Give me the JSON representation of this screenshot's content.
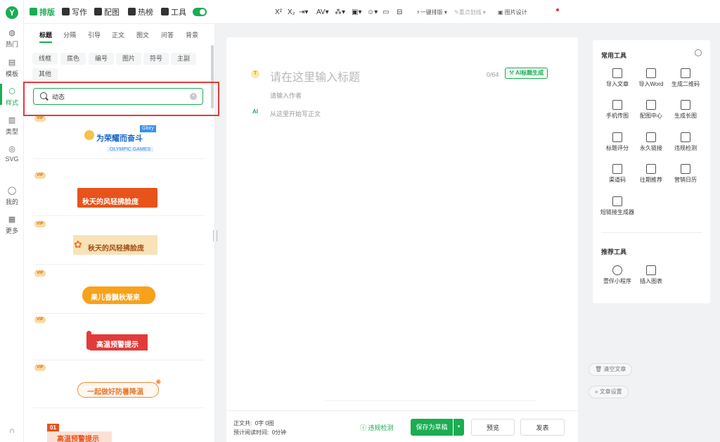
{
  "rail": {
    "items": [
      {
        "label": "热门",
        "icon": "flame-icon"
      },
      {
        "label": "模板",
        "icon": "template-icon"
      },
      {
        "label": "样式",
        "icon": "style-icon",
        "active": true
      },
      {
        "label": "类型",
        "icon": "type-icon"
      },
      {
        "label": "SVG",
        "icon": "svg-icon"
      },
      {
        "label": "我的",
        "icon": "user-icon"
      },
      {
        "label": "更多",
        "icon": "grid-icon"
      }
    ]
  },
  "topbar": {
    "tabs": [
      {
        "label": "排版",
        "active": true
      },
      {
        "label": "写作"
      },
      {
        "label": "配图"
      },
      {
        "label": "热榜"
      },
      {
        "label": "工具"
      }
    ],
    "tools": {
      "superscript": "X²",
      "subscript": "X₂",
      "one_click": "一键排版",
      "highlight": "重点划线",
      "image_design": "图片设计"
    }
  },
  "style_panel": {
    "tabs": [
      "标题",
      "分隔",
      "引导",
      "正文",
      "图文",
      "问答",
      "背景"
    ],
    "chips": [
      "线框",
      "底色",
      "编号",
      "图片",
      "符号",
      "主副",
      "其他"
    ],
    "search": {
      "value": "动态"
    },
    "vip_label": "VIP",
    "templates": [
      {
        "text": "为荣耀而奋斗",
        "badge": "Glory",
        "sub": "OLYMPIC GAMES"
      },
      {
        "text": "秋天的风轻拂脸庞"
      },
      {
        "text": "秋天的风轻拂脸庞"
      },
      {
        "text": "果儿香飘秋渐来"
      },
      {
        "text": "高温预警提示"
      },
      {
        "text": "一起做好防暑降温"
      },
      {
        "text": "高温预警提示",
        "badge": "01"
      }
    ]
  },
  "editor": {
    "title_placeholder": "请在这里输入标题",
    "title_count": "0/64",
    "ai_button": "AI标题生成",
    "author_placeholder": "请输入作者",
    "body_placeholder": "从这里开始写正文"
  },
  "footer": {
    "word_count_label": "正文共:",
    "word_count_value": "0字 0图",
    "read_time_label": "预计阅读时间:",
    "read_time_value": "0分钟",
    "check": "违规检测",
    "save": "保存为草稿",
    "preview": "预览",
    "publish": "发表"
  },
  "tools_panel": {
    "common_title": "常用工具",
    "common": [
      {
        "label": "导入文章",
        "icon": "import-icon"
      },
      {
        "label": "导入Word",
        "icon": "word-icon"
      },
      {
        "label": "生成二维码",
        "icon": "qrcode-icon"
      },
      {
        "label": "手机传图",
        "icon": "phone-icon"
      },
      {
        "label": "配图中心",
        "icon": "image-icon"
      },
      {
        "label": "生成长图",
        "icon": "long-image-icon"
      },
      {
        "label": "标题评分",
        "icon": "title-icon"
      },
      {
        "label": "永久链接",
        "icon": "link-icon"
      },
      {
        "label": "违规检测",
        "icon": "shield-icon"
      },
      {
        "label": "渠道码",
        "icon": "channel-qrcode-icon"
      },
      {
        "label": "往期推荐",
        "icon": "thumb-icon"
      },
      {
        "label": "营销日历",
        "icon": "calendar-icon"
      },
      {
        "label": "短链接生成器",
        "icon": "short-link-icon"
      }
    ],
    "recommend_title": "推荐工具",
    "recommend": [
      {
        "label": "壹伴小程序",
        "icon": "miniprogram-icon"
      },
      {
        "label": "插入图表",
        "icon": "chart-icon"
      }
    ]
  },
  "side_buttons": {
    "clear": "清空文章",
    "settings": "文章设置"
  }
}
